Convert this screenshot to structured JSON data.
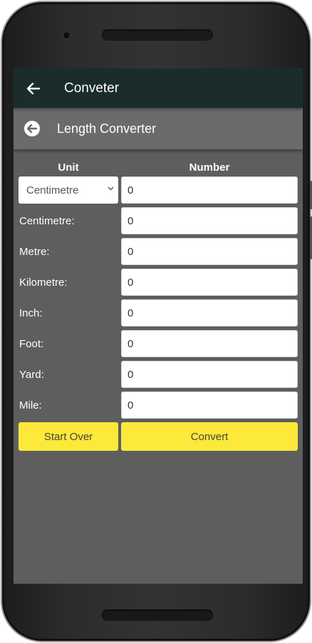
{
  "appbar": {
    "title": "Conveter"
  },
  "subbar": {
    "title": "Length Converter"
  },
  "columns": {
    "unit": "Unit",
    "number": "Number"
  },
  "unit_select": {
    "selected": "Centimetre"
  },
  "input_value": "0",
  "rows": [
    {
      "label": "Centimetre:",
      "value": "0"
    },
    {
      "label": "Metre:",
      "value": "0"
    },
    {
      "label": "Kilometre:",
      "value": "0"
    },
    {
      "label": "Inch:",
      "value": "0"
    },
    {
      "label": "Foot:",
      "value": "0"
    },
    {
      "label": "Yard:",
      "value": "0"
    },
    {
      "label": "Mile:",
      "value": "0"
    }
  ],
  "buttons": {
    "start_over": "Start Over",
    "convert": "Convert"
  },
  "colors": {
    "appbar": "#1a2d2a",
    "button": "#fde93a",
    "background": "#5e5e5e"
  },
  "icons": {
    "back": "arrow-left-icon",
    "circle_back": "circle-arrow-left-icon",
    "dropdown": "chevron-down-icon"
  }
}
